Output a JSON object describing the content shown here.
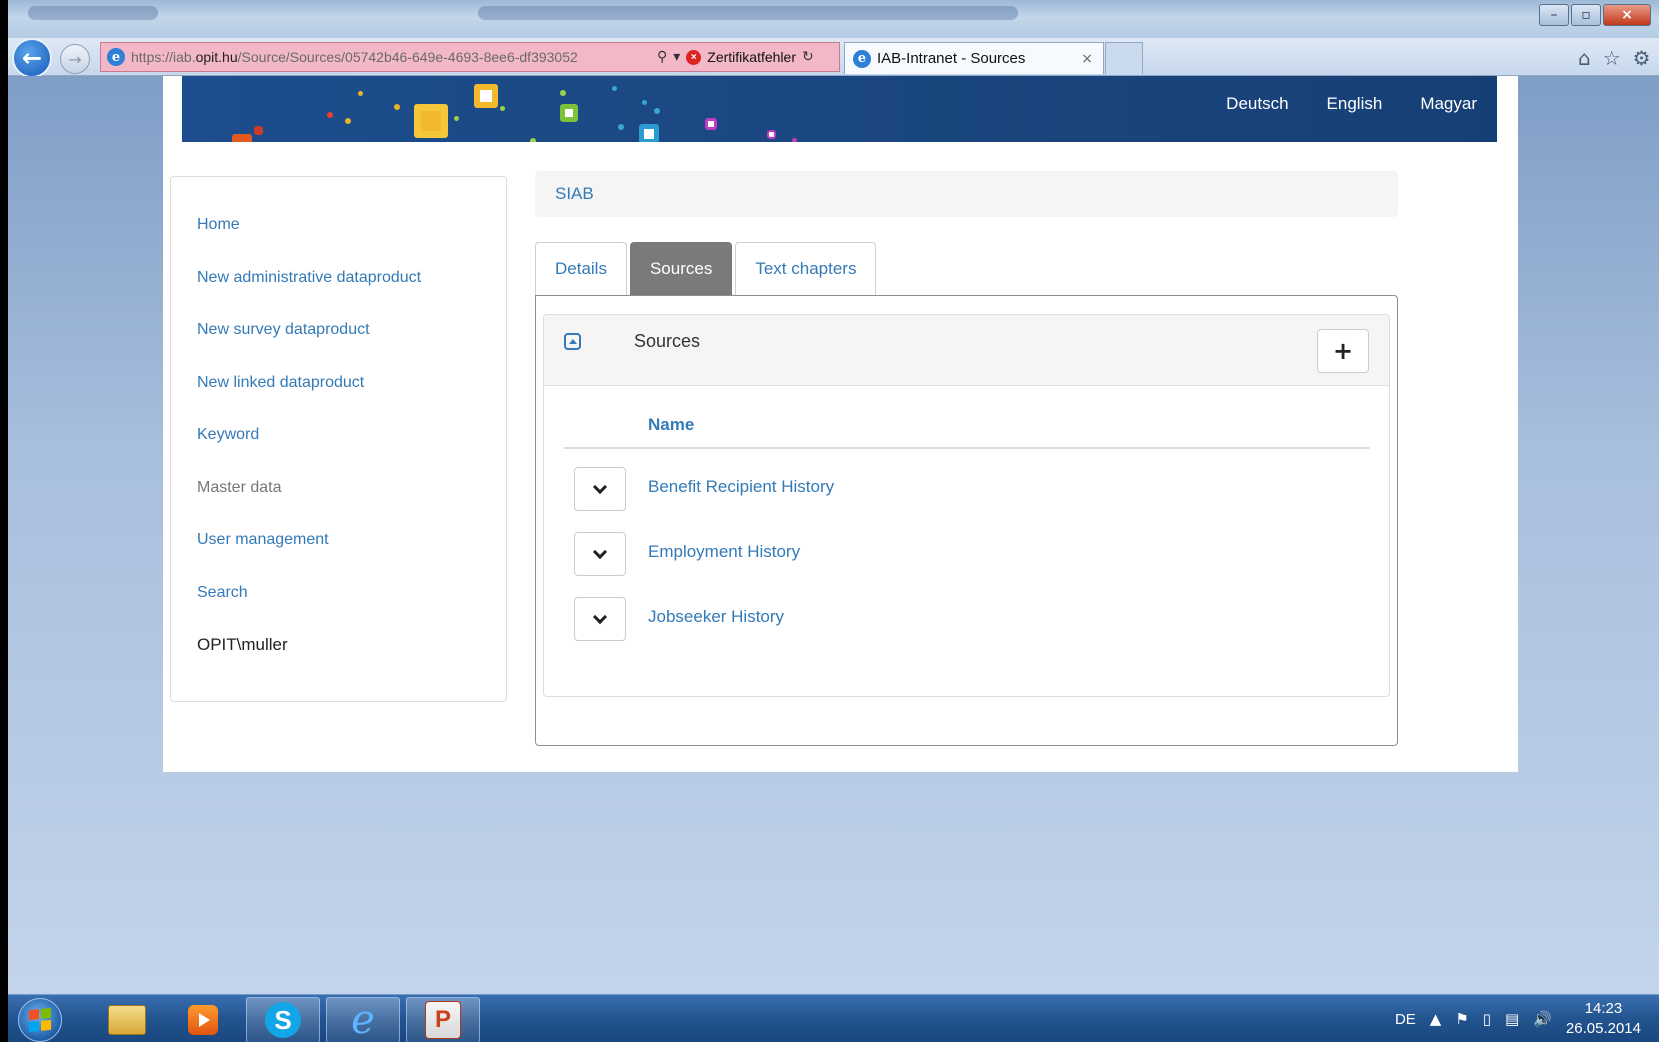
{
  "browser": {
    "url_prefix": "https://iab.",
    "url_domain": "opit.hu",
    "url_path": "/Source/Sources/05742b46-649e-4693-8ee6-df393052",
    "cert_error": "Zertifikatfehler",
    "tab_title": "IAB-Intranet - Sources",
    "tab_close": "×"
  },
  "header": {
    "languages": [
      "Deutsch",
      "English",
      "Magyar"
    ]
  },
  "sidebar": {
    "items": [
      {
        "label": "Home"
      },
      {
        "label": "New administrative dataproduct"
      },
      {
        "label": "New survey dataproduct"
      },
      {
        "label": "New linked dataproduct"
      },
      {
        "label": "Keyword"
      },
      {
        "label": "Master data"
      },
      {
        "label": "User management"
      },
      {
        "label": "Search"
      },
      {
        "label": "OPIT\\muller"
      }
    ]
  },
  "breadcrumb": {
    "label": "SIAB"
  },
  "tabs": [
    {
      "label": "Details",
      "active": false
    },
    {
      "label": "Sources",
      "active": true
    },
    {
      "label": "Text chapters",
      "active": false
    }
  ],
  "panel": {
    "title": "Sources",
    "add_label": "+",
    "column_header": "Name",
    "rows": [
      {
        "name": "Benefit Recipient History"
      },
      {
        "name": "Employment History"
      },
      {
        "name": "Jobseeker History"
      }
    ]
  },
  "taskbar": {
    "language": "DE",
    "time": "14:23",
    "date": "26.05.2014"
  },
  "colors": {
    "link": "#337ab7",
    "banner": "#1b4780",
    "active_tab": "#7a7a7a"
  }
}
